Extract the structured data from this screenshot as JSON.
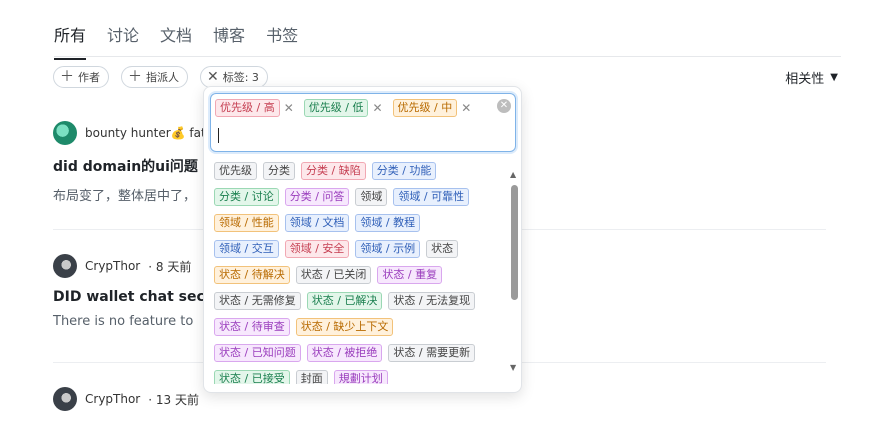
{
  "tabs": [
    {
      "label": "所有",
      "active": true
    },
    {
      "label": "讨论",
      "active": false
    },
    {
      "label": "文档",
      "active": false
    },
    {
      "label": "博客",
      "active": false
    },
    {
      "label": "书签",
      "active": false
    }
  ],
  "filters": {
    "author": "作者",
    "assignee": "指派人",
    "tags": "标签: 3"
  },
  "sort": {
    "label": "相关性"
  },
  "tag_picker": {
    "selected": [
      {
        "label": "优先级 / 高",
        "color": "red"
      },
      {
        "label": "优先级 / 低",
        "color": "green"
      },
      {
        "label": "优先级 / 中",
        "color": "orange"
      }
    ],
    "options": [
      [
        {
          "label": "优先级",
          "color": "gray"
        },
        {
          "label": "分类",
          "color": "gray"
        },
        {
          "label": "分类 / 缺陷",
          "color": "red"
        },
        {
          "label": "分类 / 功能",
          "color": "blue"
        }
      ],
      [
        {
          "label": "分类 / 讨论",
          "color": "green"
        },
        {
          "label": "分类 / 问答",
          "color": "purple"
        },
        {
          "label": "领域",
          "color": "gray"
        },
        {
          "label": "领域 / 可靠性",
          "color": "blue"
        }
      ],
      [
        {
          "label": "领域 / 性能",
          "color": "orange"
        },
        {
          "label": "领域 / 文档",
          "color": "blue"
        },
        {
          "label": "领域 / 教程",
          "color": "blue"
        }
      ],
      [
        {
          "label": "领域 / 交互",
          "color": "blue"
        },
        {
          "label": "领域 / 安全",
          "color": "red"
        },
        {
          "label": "领域 / 示例",
          "color": "blue"
        },
        {
          "label": "状态",
          "color": "gray"
        }
      ],
      [
        {
          "label": "状态 / 待解决",
          "color": "orange"
        },
        {
          "label": "状态 / 已关闭",
          "color": "gray"
        },
        {
          "label": "状态 / 重复",
          "color": "purple"
        }
      ],
      [
        {
          "label": "状态 / 无需修复",
          "color": "gray"
        },
        {
          "label": "状态 / 已解决",
          "color": "green"
        },
        {
          "label": "状态 / 无法复现",
          "color": "gray"
        }
      ],
      [
        {
          "label": "状态 / 待审查",
          "color": "purple"
        },
        {
          "label": "状态 / 缺少上下文",
          "color": "orange"
        }
      ],
      [
        {
          "label": "状态 / 已知问题",
          "color": "purple"
        },
        {
          "label": "状态 / 被拒绝",
          "color": "purple"
        },
        {
          "label": "状态 / 需要更新",
          "color": "gray"
        }
      ],
      [
        {
          "label": "状态 / 已接受",
          "color": "green"
        },
        {
          "label": "封面",
          "color": "gray"
        },
        {
          "label": "規劃计划",
          "color": "purple"
        }
      ]
    ]
  },
  "posts": [
    {
      "author": "bounty hunter💰 faty",
      "time": "",
      "title": "did domain的ui问题",
      "excerpt": "布局变了，整体居中了，"
    },
    {
      "author": "CrypThor",
      "time": "· 8 天前",
      "title": "DID wallet chat sec",
      "excerpt": "There is no feature to"
    },
    {
      "author": "CrypThor",
      "time": "· 13 天前",
      "title": "",
      "excerpt": ""
    }
  ]
}
